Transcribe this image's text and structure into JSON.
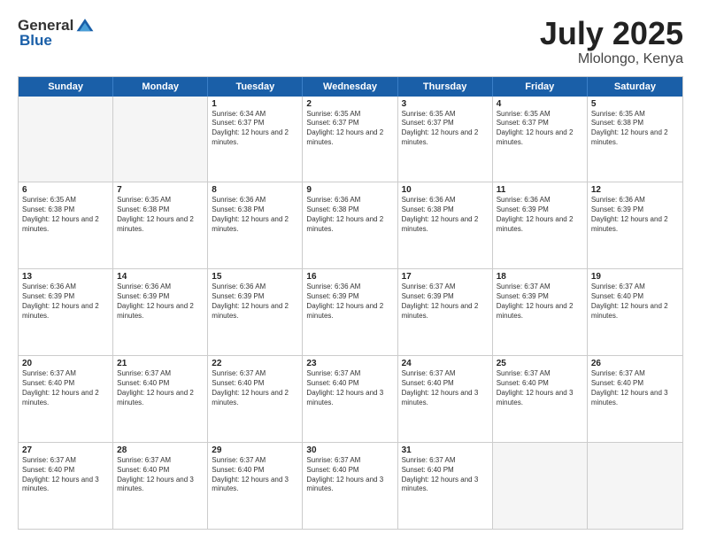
{
  "logo": {
    "general": "General",
    "blue": "Blue"
  },
  "title": "July 2025",
  "location": "Mlolongo, Kenya",
  "days": [
    "Sunday",
    "Monday",
    "Tuesday",
    "Wednesday",
    "Thursday",
    "Friday",
    "Saturday"
  ],
  "weeks": [
    [
      {
        "day": "",
        "text": "",
        "empty": true
      },
      {
        "day": "",
        "text": "",
        "empty": true
      },
      {
        "day": "1",
        "text": "Sunrise: 6:34 AM\nSunset: 6:37 PM\nDaylight: 12 hours and 2 minutes."
      },
      {
        "day": "2",
        "text": "Sunrise: 6:35 AM\nSunset: 6:37 PM\nDaylight: 12 hours and 2 minutes."
      },
      {
        "day": "3",
        "text": "Sunrise: 6:35 AM\nSunset: 6:37 PM\nDaylight: 12 hours and 2 minutes."
      },
      {
        "day": "4",
        "text": "Sunrise: 6:35 AM\nSunset: 6:37 PM\nDaylight: 12 hours and 2 minutes."
      },
      {
        "day": "5",
        "text": "Sunrise: 6:35 AM\nSunset: 6:38 PM\nDaylight: 12 hours and 2 minutes."
      }
    ],
    [
      {
        "day": "6",
        "text": "Sunrise: 6:35 AM\nSunset: 6:38 PM\nDaylight: 12 hours and 2 minutes."
      },
      {
        "day": "7",
        "text": "Sunrise: 6:35 AM\nSunset: 6:38 PM\nDaylight: 12 hours and 2 minutes."
      },
      {
        "day": "8",
        "text": "Sunrise: 6:36 AM\nSunset: 6:38 PM\nDaylight: 12 hours and 2 minutes."
      },
      {
        "day": "9",
        "text": "Sunrise: 6:36 AM\nSunset: 6:38 PM\nDaylight: 12 hours and 2 minutes."
      },
      {
        "day": "10",
        "text": "Sunrise: 6:36 AM\nSunset: 6:38 PM\nDaylight: 12 hours and 2 minutes."
      },
      {
        "day": "11",
        "text": "Sunrise: 6:36 AM\nSunset: 6:39 PM\nDaylight: 12 hours and 2 minutes."
      },
      {
        "day": "12",
        "text": "Sunrise: 6:36 AM\nSunset: 6:39 PM\nDaylight: 12 hours and 2 minutes."
      }
    ],
    [
      {
        "day": "13",
        "text": "Sunrise: 6:36 AM\nSunset: 6:39 PM\nDaylight: 12 hours and 2 minutes."
      },
      {
        "day": "14",
        "text": "Sunrise: 6:36 AM\nSunset: 6:39 PM\nDaylight: 12 hours and 2 minutes."
      },
      {
        "day": "15",
        "text": "Sunrise: 6:36 AM\nSunset: 6:39 PM\nDaylight: 12 hours and 2 minutes."
      },
      {
        "day": "16",
        "text": "Sunrise: 6:36 AM\nSunset: 6:39 PM\nDaylight: 12 hours and 2 minutes."
      },
      {
        "day": "17",
        "text": "Sunrise: 6:37 AM\nSunset: 6:39 PM\nDaylight: 12 hours and 2 minutes."
      },
      {
        "day": "18",
        "text": "Sunrise: 6:37 AM\nSunset: 6:39 PM\nDaylight: 12 hours and 2 minutes."
      },
      {
        "day": "19",
        "text": "Sunrise: 6:37 AM\nSunset: 6:40 PM\nDaylight: 12 hours and 2 minutes."
      }
    ],
    [
      {
        "day": "20",
        "text": "Sunrise: 6:37 AM\nSunset: 6:40 PM\nDaylight: 12 hours and 2 minutes."
      },
      {
        "day": "21",
        "text": "Sunrise: 6:37 AM\nSunset: 6:40 PM\nDaylight: 12 hours and 2 minutes."
      },
      {
        "day": "22",
        "text": "Sunrise: 6:37 AM\nSunset: 6:40 PM\nDaylight: 12 hours and 2 minutes."
      },
      {
        "day": "23",
        "text": "Sunrise: 6:37 AM\nSunset: 6:40 PM\nDaylight: 12 hours and 3 minutes."
      },
      {
        "day": "24",
        "text": "Sunrise: 6:37 AM\nSunset: 6:40 PM\nDaylight: 12 hours and 3 minutes."
      },
      {
        "day": "25",
        "text": "Sunrise: 6:37 AM\nSunset: 6:40 PM\nDaylight: 12 hours and 3 minutes."
      },
      {
        "day": "26",
        "text": "Sunrise: 6:37 AM\nSunset: 6:40 PM\nDaylight: 12 hours and 3 minutes."
      }
    ],
    [
      {
        "day": "27",
        "text": "Sunrise: 6:37 AM\nSunset: 6:40 PM\nDaylight: 12 hours and 3 minutes."
      },
      {
        "day": "28",
        "text": "Sunrise: 6:37 AM\nSunset: 6:40 PM\nDaylight: 12 hours and 3 minutes."
      },
      {
        "day": "29",
        "text": "Sunrise: 6:37 AM\nSunset: 6:40 PM\nDaylight: 12 hours and 3 minutes."
      },
      {
        "day": "30",
        "text": "Sunrise: 6:37 AM\nSunset: 6:40 PM\nDaylight: 12 hours and 3 minutes."
      },
      {
        "day": "31",
        "text": "Sunrise: 6:37 AM\nSunset: 6:40 PM\nDaylight: 12 hours and 3 minutes."
      },
      {
        "day": "",
        "text": "",
        "empty": true
      },
      {
        "day": "",
        "text": "",
        "empty": true
      }
    ]
  ]
}
